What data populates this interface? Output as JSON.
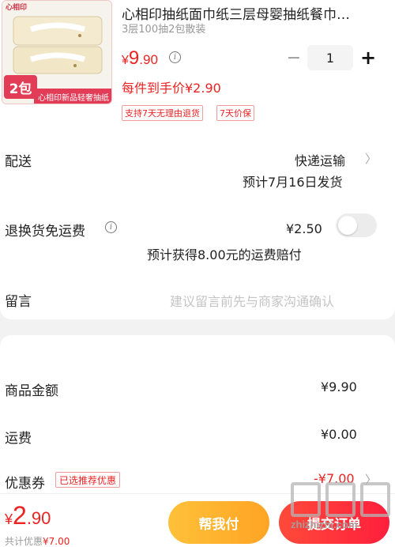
{
  "product": {
    "image_logo_text": "心相印",
    "image_badge": "2包",
    "image_banner": "心相印新品轻奢抽纸",
    "title": "心相印抽纸面巾纸三层母婴抽纸餐巾…",
    "spec": "3层100抽2包散装",
    "price_currency": "¥",
    "price_int": "9",
    "price_dec": ".90",
    "quantity": "1",
    "per_piece_price": "每件到手价¥2.90",
    "tags": [
      "支持7天无理由退货",
      "7天价保"
    ]
  },
  "delivery": {
    "label": "配送",
    "method": "快递运输",
    "estimate": "预计7月16日发货"
  },
  "return_shipping": {
    "label": "退换货免运费",
    "price": "¥2.50",
    "note": "预计获得8.00元的运费赔付",
    "enabled": false
  },
  "message": {
    "label": "留言",
    "placeholder": "建议留言前先与商家沟通确认"
  },
  "summary": {
    "goods_label": "商品金额",
    "goods_value": "¥9.90",
    "shipping_label": "运费",
    "shipping_value": "¥0.00",
    "coupon_label": "优惠券",
    "coupon_tag": "已选推荐优惠",
    "coupon_value": "-¥7.00"
  },
  "bottom_bar": {
    "total_currency": "¥",
    "total_int": "2",
    "total_dec": ".90",
    "saved_label": "共计优惠",
    "saved_value": "¥7.00",
    "help_pay_label": "帮我付",
    "pay_label": "提交订单"
  },
  "watermark": {
    "site": "zhizhizhi.com"
  },
  "colors": {
    "accent_red": "#ee2222",
    "help_button": "#ffb12e",
    "pay_button": "#ff2d3b"
  }
}
